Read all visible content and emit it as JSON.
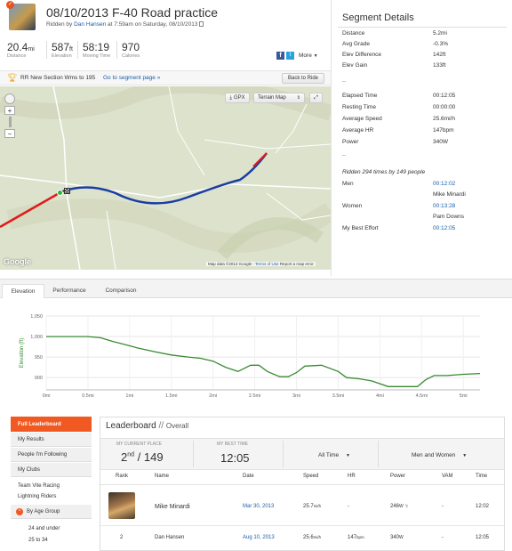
{
  "header": {
    "title": "08/10/2013 F-40 Road practice",
    "ridden_by_prefix": "Ridden by",
    "rider": "Dan Hansen",
    "ridden_at": "at 7:59am on Saturday, 08/10/2013"
  },
  "stats": [
    {
      "value": "20.4",
      "unit": "mi",
      "label": "Distance"
    },
    {
      "value": "587",
      "unit": "ft",
      "label": "Elevation"
    },
    {
      "value": "58:19",
      "unit": "",
      "label": "Moving Time"
    },
    {
      "value": "970",
      "unit": "",
      "label": "Calories"
    }
  ],
  "social": {
    "more_label": "More"
  },
  "segment_bar": {
    "name": "RR New Section Wms to 195",
    "goto_link": "Go to segment page »",
    "back_button": "Back to Ride"
  },
  "map": {
    "gpx_label": "GPX",
    "map_type": "Terrain Map",
    "attribution": "Map data ©2013 Google",
    "terms": "Terms of Use",
    "report": "Report a map error",
    "logo": "Google"
  },
  "segment_details": {
    "title": "Segment Details",
    "rows1": [
      {
        "k": "Distance",
        "v": "5.2mi"
      },
      {
        "k": "Avg Grade",
        "v": "-0.3%"
      },
      {
        "k": "Elev Difference",
        "v": "142ft"
      },
      {
        "k": "Elev Gain",
        "v": "133ft"
      }
    ],
    "dash1": "--",
    "rows2": [
      {
        "k": "Elapsed Time",
        "v": "00:12:05"
      },
      {
        "k": "Resting Time",
        "v": "00:00:00"
      },
      {
        "k": "Average Speed",
        "v": "25.6mi/h"
      },
      {
        "k": "Average HR",
        "v": "147bpm"
      },
      {
        "k": "Power",
        "v": "340W"
      }
    ],
    "dash2": "--",
    "ridden_summary": "Ridden 294 times by 149 people",
    "men_label": "Men",
    "men_time": "00:12:02",
    "men_name": "Mike Minardi",
    "women_label": "Women",
    "women_time": "00:13:28",
    "women_name": "Pam Downs",
    "best_label": "My Best Effort",
    "best_time": "00:12:05"
  },
  "tabs": [
    "Elevation",
    "Performance",
    "Comparison"
  ],
  "chart_data": {
    "type": "area",
    "title": "",
    "xlabel": "",
    "ylabel": "Elevation (ft)",
    "x_ticks": [
      "0mi",
      "0.5mi",
      "1mi",
      "1.5mi",
      "2mi",
      "2.5mi",
      "3mi",
      "3.5mi",
      "4mi",
      "4.5mi",
      "5mi"
    ],
    "y_ticks": [
      "1,050",
      "1,000",
      "950",
      "900"
    ],
    "ylim": [
      870,
      1050
    ],
    "xlim": [
      0,
      5.2
    ],
    "color": "#3a8a32",
    "x": [
      0,
      0.25,
      0.5,
      0.65,
      0.8,
      0.95,
      1.1,
      1.3,
      1.5,
      1.7,
      1.85,
      2.0,
      2.15,
      2.3,
      2.45,
      2.55,
      2.65,
      2.8,
      2.9,
      3.0,
      3.1,
      3.3,
      3.5,
      3.6,
      3.75,
      3.9,
      4.1,
      4.3,
      4.45,
      4.55,
      4.65,
      4.8,
      5.0,
      5.2
    ],
    "y": [
      1000,
      1000,
      1000,
      997,
      988,
      980,
      972,
      963,
      955,
      950,
      947,
      940,
      925,
      915,
      930,
      930,
      915,
      902,
      902,
      912,
      928,
      930,
      915,
      900,
      897,
      892,
      878,
      878,
      878,
      895,
      905,
      905,
      908,
      910
    ]
  },
  "sidebar": {
    "active": "Full Leaderboard",
    "items": [
      "My Results",
      "People I'm Following",
      "My Clubs"
    ],
    "clubs": [
      "Team Vite Racing",
      "Lightning Riders"
    ],
    "age_group": "By Age Group",
    "ages": [
      "24 and under",
      "25 to 34"
    ]
  },
  "leaderboard": {
    "title": "Leaderboard",
    "sep": "//",
    "subtitle": "Overall",
    "current_place_label": "MY CURRENT PLACE",
    "current_place": "2",
    "current_suffix": "nd",
    "current_total": "/ 149",
    "best_time_label": "MY BEST TIME",
    "best_time": "12:05",
    "time_filter": "All Time",
    "gender_filter": "Men and Women",
    "columns": [
      "Rank",
      "Name",
      "Date",
      "Speed",
      "HR",
      "Power",
      "VAM",
      "Time"
    ],
    "rows": [
      {
        "rank": "",
        "name": "Mike Minardi",
        "date": "Mar 30, 2013",
        "speed": "25.7",
        "speed_unit": "mi/h",
        "hr": "-",
        "power": "246",
        "power_unit": "W",
        "vam": "-",
        "time": "12:02"
      },
      {
        "rank": "2",
        "name": "Dan Hansen",
        "date": "Aug 10, 2013",
        "speed": "25.6",
        "speed_unit": "mi/h",
        "hr": "147",
        "hr_unit": "bpm",
        "power": "340",
        "power_unit": "W",
        "vam": "-",
        "time": "12:05"
      }
    ]
  }
}
